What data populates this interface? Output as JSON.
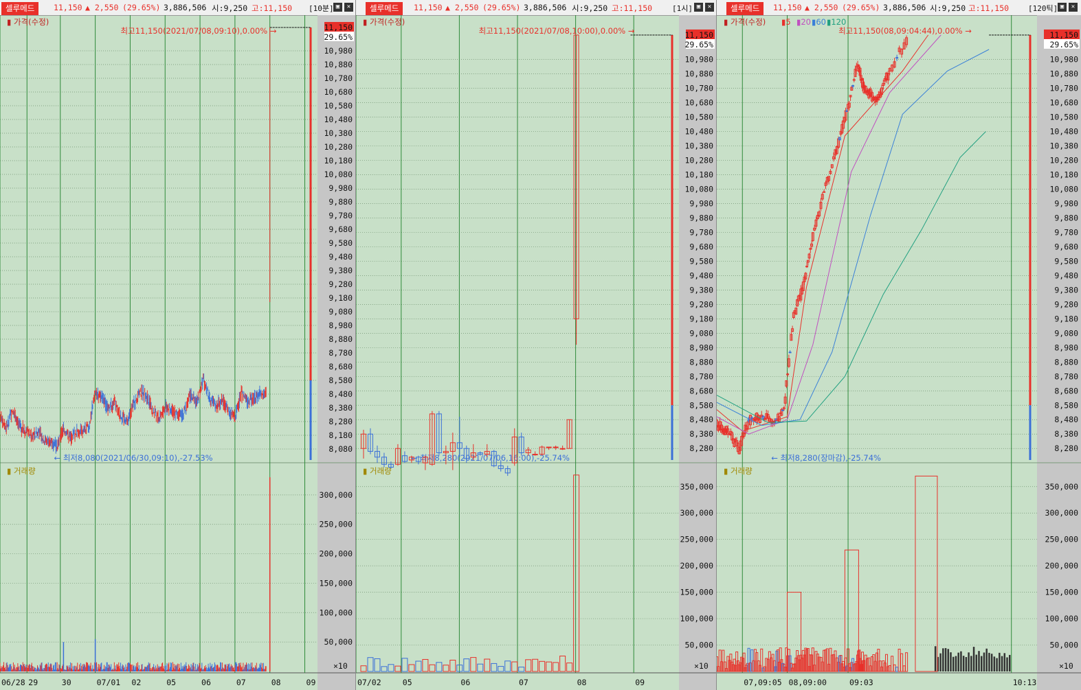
{
  "common": {
    "name": "셀루메드",
    "price": "11,150",
    "change": "▲ 2,550",
    "rate": "(29.65%)",
    "volume": "3,886,506",
    "open": "시:9,250",
    "high": "고:11,150",
    "price_tag": "11,150",
    "rate_tag": "29.65%",
    "price_title": "가격(수정)",
    "volume_title": "거래량",
    "unit": "×10",
    "colors": {
      "up": "#e8302a",
      "down": "#3a6fd8",
      "grid_vline": "#2f8a3a",
      "bg": "#c8e0c8"
    }
  },
  "panels": [
    {
      "period": "[10분]",
      "hi_note": "최고11,150(2021/07/08,09:10),0.00%",
      "lo_note": "최저8,080(2021/06/30,09:10),-27.53%"
    },
    {
      "period": "[1시]",
      "hi_note": "최고11,150(2021/07/08,10:00),0.00%",
      "lo_note": "최저8,280(2021/07/06,16:00),-25.74%"
    },
    {
      "period": "[120틱]",
      "hi_note": "최고11,150(08,09:04:44),0.00%",
      "lo_note": "최저8,280(장마감),-25.74%",
      "ma_legend": [
        "5",
        "20",
        "60",
        "120"
      ]
    }
  ],
  "chart_data": [
    {
      "type": "candlestick",
      "period": "10분",
      "price_axis_ticks": [
        8080,
        8180,
        8280,
        8380,
        8480,
        8580,
        8680,
        8780,
        8880,
        8980,
        9080,
        9180,
        9280,
        9380,
        9480,
        9580,
        9680,
        9780,
        9880,
        9980,
        10080,
        10180,
        10280,
        10380,
        10480,
        10580,
        10680,
        10780,
        10880,
        10980
      ],
      "price_axis_labels": [
        "8,080",
        "8,180",
        "8,280",
        "8,380",
        "8,480",
        "8,580",
        "8,680",
        "8,780",
        "8,880",
        "8,980",
        "9,080",
        "9,180",
        "9,280",
        "9,380",
        "9,480",
        "9,580",
        "9,680",
        "9,780",
        "9,880",
        "9,980",
        "10,080",
        "10,180",
        "10,280",
        "10,380",
        "10,480",
        "10,580",
        "10,680",
        "10,780",
        "10,880",
        "10,980"
      ],
      "ylim": [
        8000,
        11200
      ],
      "x_labels": [
        "06/28",
        "29",
        "30",
        "07/01",
        "02",
        "05",
        "06",
        "07",
        "08",
        "09"
      ],
      "x_label_frac": [
        0.0,
        0.085,
        0.19,
        0.3,
        0.41,
        0.52,
        0.63,
        0.74,
        0.85,
        0.96
      ],
      "overview": [
        {
          "t": 0.0,
          "v": 8330
        },
        {
          "t": 0.02,
          "v": 8240
        },
        {
          "t": 0.04,
          "v": 8360
        },
        {
          "t": 0.06,
          "v": 8250
        },
        {
          "t": 0.08,
          "v": 8210
        },
        {
          "t": 0.1,
          "v": 8180
        },
        {
          "t": 0.12,
          "v": 8200
        },
        {
          "t": 0.14,
          "v": 8150
        },
        {
          "t": 0.16,
          "v": 8130
        },
        {
          "t": 0.18,
          "v": 8100
        },
        {
          "t": 0.2,
          "v": 8230
        },
        {
          "t": 0.22,
          "v": 8160
        },
        {
          "t": 0.24,
          "v": 8200
        },
        {
          "t": 0.26,
          "v": 8210
        },
        {
          "t": 0.28,
          "v": 8240
        },
        {
          "t": 0.3,
          "v": 8500
        },
        {
          "t": 0.32,
          "v": 8450
        },
        {
          "t": 0.34,
          "v": 8370
        },
        {
          "t": 0.36,
          "v": 8420
        },
        {
          "t": 0.38,
          "v": 8330
        },
        {
          "t": 0.4,
          "v": 8280
        },
        {
          "t": 0.42,
          "v": 8400
        },
        {
          "t": 0.44,
          "v": 8500
        },
        {
          "t": 0.46,
          "v": 8470
        },
        {
          "t": 0.48,
          "v": 8360
        },
        {
          "t": 0.5,
          "v": 8310
        },
        {
          "t": 0.52,
          "v": 8380
        },
        {
          "t": 0.54,
          "v": 8360
        },
        {
          "t": 0.56,
          "v": 8320
        },
        {
          "t": 0.58,
          "v": 8350
        },
        {
          "t": 0.6,
          "v": 8480
        },
        {
          "t": 0.62,
          "v": 8420
        },
        {
          "t": 0.64,
          "v": 8590
        },
        {
          "t": 0.66,
          "v": 8450
        },
        {
          "t": 0.68,
          "v": 8400
        },
        {
          "t": 0.7,
          "v": 8430
        },
        {
          "t": 0.72,
          "v": 8360
        },
        {
          "t": 0.74,
          "v": 8310
        },
        {
          "t": 0.76,
          "v": 8480
        },
        {
          "t": 0.78,
          "v": 8430
        },
        {
          "t": 0.8,
          "v": 8450
        },
        {
          "t": 0.82,
          "v": 8480
        },
        {
          "t": 0.84,
          "v": 8500
        },
        {
          "t": 0.85,
          "v": 11150
        }
      ],
      "volume_axis_ticks": [
        50000,
        100000,
        150000,
        200000,
        250000,
        300000
      ],
      "volume_axis_labels": [
        "50,000",
        "100,000",
        "150,000",
        "200,000",
        "250,000",
        "300,000"
      ],
      "volume_ylim": [
        0,
        350000
      ],
      "volume_spikes": [
        {
          "t": 0.2,
          "v": 50000
        },
        {
          "t": 0.3,
          "v": 55000
        },
        {
          "t": 0.85,
          "v": 330000
        }
      ]
    },
    {
      "type": "candlestick",
      "period": "1시",
      "price_axis_ticks": [
        8280,
        8380,
        8480,
        8580,
        8680,
        8780,
        8880,
        8980,
        9080,
        9180,
        9280,
        9380,
        9480,
        9580,
        9680,
        9780,
        9880,
        9980,
        10080,
        10180,
        10280,
        10380,
        10480,
        10580,
        10680,
        10780,
        10880,
        10980
      ],
      "price_axis_labels": [
        "8,280",
        "8,380",
        "8,480",
        "8,580",
        "8,680",
        "8,780",
        "8,880",
        "8,980",
        "9,080",
        "9,180",
        "9,280",
        "9,380",
        "9,480",
        "9,580",
        "9,680",
        "9,780",
        "9,880",
        "9,980",
        "10,080",
        "10,180",
        "10,280",
        "10,380",
        "10,480",
        "10,580",
        "10,680",
        "10,780",
        "10,880",
        "10,980"
      ],
      "ylim": [
        8200,
        11250
      ],
      "x_labels": [
        "07/02",
        "05",
        "06",
        "07",
        "08",
        "09"
      ],
      "x_label_frac": [
        0.0,
        0.14,
        0.32,
        0.5,
        0.68,
        0.86
      ],
      "candles": [
        {
          "o": 8280,
          "h": 8410,
          "l": 8210,
          "c": 8380
        },
        {
          "o": 8380,
          "h": 8420,
          "l": 8240,
          "c": 8260
        },
        {
          "o": 8260,
          "h": 8300,
          "l": 8180,
          "c": 8220
        },
        {
          "o": 8220,
          "h": 8250,
          "l": 8150,
          "c": 8170
        },
        {
          "o": 8170,
          "h": 8190,
          "l": 8140,
          "c": 8150
        },
        {
          "o": 8170,
          "h": 8310,
          "l": 8160,
          "c": 8280
        },
        {
          "o": 8230,
          "h": 8260,
          "l": 8180,
          "c": 8190
        },
        {
          "o": 8200,
          "h": 8230,
          "l": 8180,
          "c": 8220
        },
        {
          "o": 8220,
          "h": 8230,
          "l": 8170,
          "c": 8190
        },
        {
          "o": 8180,
          "h": 8230,
          "l": 8130,
          "c": 8220
        },
        {
          "o": 8170,
          "h": 8540,
          "l": 8160,
          "c": 8520
        },
        {
          "o": 8520,
          "h": 8540,
          "l": 8230,
          "c": 8250
        },
        {
          "o": 8250,
          "h": 8300,
          "l": 8170,
          "c": 8260
        },
        {
          "o": 8260,
          "h": 8390,
          "l": 8130,
          "c": 8320
        },
        {
          "o": 8320,
          "h": 8500,
          "l": 8220,
          "c": 8280
        },
        {
          "o": 8280,
          "h": 8300,
          "l": 8180,
          "c": 8210
        },
        {
          "o": 8220,
          "h": 8310,
          "l": 8200,
          "c": 8250
        },
        {
          "o": 8250,
          "h": 8260,
          "l": 8230,
          "c": 8240
        },
        {
          "o": 8240,
          "h": 8310,
          "l": 8220,
          "c": 8260
        },
        {
          "o": 8260,
          "h": 8270,
          "l": 8150,
          "c": 8160
        },
        {
          "o": 8160,
          "h": 8200,
          "l": 8120,
          "c": 8140
        },
        {
          "o": 8140,
          "h": 8160,
          "l": 8090,
          "c": 8110
        },
        {
          "o": 8180,
          "h": 8420,
          "l": 8160,
          "c": 8360
        },
        {
          "o": 8360,
          "h": 8390,
          "l": 8230,
          "c": 8250
        },
        {
          "o": 8250,
          "h": 8290,
          "l": 8230,
          "c": 8270
        },
        {
          "o": 8240,
          "h": 8260,
          "l": 8230,
          "c": 8240
        },
        {
          "o": 8240,
          "h": 8300,
          "l": 8230,
          "c": 8290
        },
        {
          "o": 8290,
          "h": 8290,
          "l": 8270,
          "c": 8290
        },
        {
          "o": 8290,
          "h": 8300,
          "l": 8270,
          "c": 8290
        },
        {
          "o": 8280,
          "h": 8300,
          "l": 8270,
          "c": 8280
        },
        {
          "o": 8280,
          "h": 8480,
          "l": 8280,
          "c": 8480
        },
        {
          "o": 9180,
          "h": 11150,
          "l": 9000,
          "c": 11150
        }
      ],
      "volume_axis_ticks": [
        50000,
        100000,
        150000,
        200000,
        250000,
        300000,
        350000
      ],
      "volume_axis_labels": [
        "50,000",
        "100,000",
        "150,000",
        "200,000",
        "250,000",
        "300,000",
        "350,000"
      ],
      "volume_ylim": [
        0,
        390000
      ]
    },
    {
      "type": "candlestick",
      "period": "120틱",
      "price_axis_ticks": [
        8280,
        8380,
        8480,
        8580,
        8680,
        8780,
        8880,
        8980,
        9080,
        9180,
        9280,
        9380,
        9480,
        9580,
        9680,
        9780,
        9880,
        9980,
        10080,
        10180,
        10280,
        10380,
        10480,
        10580,
        10680,
        10780,
        10880,
        10980
      ],
      "price_axis_labels": [
        "8,280",
        "8,380",
        "8,480",
        "8,580",
        "8,680",
        "8,780",
        "8,880",
        "8,980",
        "9,080",
        "9,180",
        "9,280",
        "9,380",
        "9,480",
        "9,580",
        "9,680",
        "9,780",
        "9,880",
        "9,980",
        "10,080",
        "10,180",
        "10,280",
        "10,380",
        "10,480",
        "10,580",
        "10,680",
        "10,780",
        "10,880",
        "10,980"
      ],
      "ylim": [
        8200,
        11250
      ],
      "x_labels": [
        "07,09:05",
        "08,09:00",
        "09:03",
        "10:13"
      ],
      "x_label_frac": [
        0.08,
        0.22,
        0.41,
        0.92
      ],
      "price_path": [
        {
          "t": 0.0,
          "v": 8450
        },
        {
          "t": 0.04,
          "v": 8380
        },
        {
          "t": 0.07,
          "v": 8280
        },
        {
          "t": 0.1,
          "v": 8480
        },
        {
          "t": 0.14,
          "v": 8500
        },
        {
          "t": 0.18,
          "v": 8460
        },
        {
          "t": 0.21,
          "v": 8550
        },
        {
          "t": 0.24,
          "v": 9200
        },
        {
          "t": 0.27,
          "v": 9400
        },
        {
          "t": 0.3,
          "v": 9750
        },
        {
          "t": 0.34,
          "v": 10100
        },
        {
          "t": 0.38,
          "v": 10400
        },
        {
          "t": 0.41,
          "v": 10650
        },
        {
          "t": 0.44,
          "v": 10950
        },
        {
          "t": 0.46,
          "v": 10780
        },
        {
          "t": 0.5,
          "v": 10700
        },
        {
          "t": 0.54,
          "v": 10900
        },
        {
          "t": 0.6,
          "v": 11150
        }
      ],
      "ma_lines": [
        {
          "name": "5",
          "color": "#e8302a",
          "points": [
            [
              0.0,
              8550
            ],
            [
              0.08,
              8400
            ],
            [
              0.22,
              8500
            ],
            [
              0.28,
              9400
            ],
            [
              0.4,
              10450
            ],
            [
              0.5,
              10700
            ],
            [
              0.58,
              10900
            ],
            [
              0.66,
              11150
            ]
          ]
        },
        {
          "name": "20",
          "color": "#c050c0",
          "points": [
            [
              0.0,
              8500
            ],
            [
              0.1,
              8380
            ],
            [
              0.22,
              8480
            ],
            [
              0.3,
              9000
            ],
            [
              0.42,
              10200
            ],
            [
              0.54,
              10750
            ],
            [
              0.7,
              11150
            ]
          ]
        },
        {
          "name": "60",
          "color": "#3a80d8",
          "points": [
            [
              0.0,
              8600
            ],
            [
              0.14,
              8440
            ],
            [
              0.26,
              8480
            ],
            [
              0.36,
              8950
            ],
            [
              0.48,
              9900
            ],
            [
              0.58,
              10600
            ],
            [
              0.72,
              10900
            ],
            [
              0.85,
              11050
            ]
          ]
        },
        {
          "name": "120",
          "color": "#20a080",
          "points": [
            [
              0.0,
              8650
            ],
            [
              0.16,
              8460
            ],
            [
              0.28,
              8470
            ],
            [
              0.4,
              8780
            ],
            [
              0.52,
              9350
            ],
            [
              0.64,
              9800
            ],
            [
              0.76,
              10300
            ],
            [
              0.84,
              10480
            ]
          ]
        }
      ],
      "volume_axis_ticks": [
        50000,
        100000,
        150000,
        200000,
        250000,
        300000,
        350000
      ],
      "volume_axis_labels": [
        "50,000",
        "100,000",
        "150,000",
        "200,000",
        "250,000",
        "300,000",
        "350,000"
      ],
      "volume_ylim": [
        0,
        390000
      ],
      "volume_spikes": [
        {
          "t": 0.22,
          "v": 150000
        },
        {
          "t": 0.4,
          "v": 230000
        },
        {
          "t": 0.62,
          "v": 370000
        }
      ]
    }
  ]
}
